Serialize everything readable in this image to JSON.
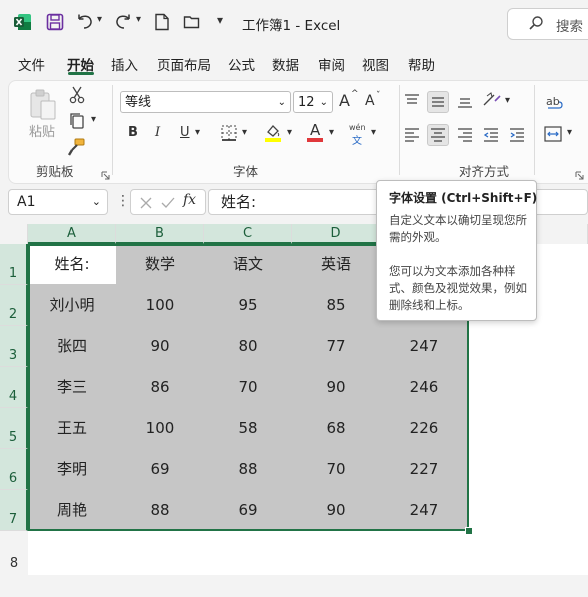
{
  "titlebar": {
    "title": "工作簿1 - Excel",
    "search_placeholder": "搜索",
    "qat_more": "▾"
  },
  "tabs": [
    "文件",
    "开始",
    "插入",
    "页面布局",
    "公式",
    "数据",
    "审阅",
    "视图",
    "帮助"
  ],
  "active_tab": "开始",
  "ribbon": {
    "clipboard": {
      "paste_label": "粘贴",
      "group_label": "剪贴板"
    },
    "font": {
      "font_name": "等线",
      "font_size": "12",
      "bold": "B",
      "italic": "I",
      "underline": "U",
      "font_color_letter": "A",
      "phonetic_top": "wén",
      "phonetic_bottom": "文",
      "grow": "A",
      "shrink": "A",
      "group_label": "字体"
    },
    "alignment": {
      "group_label": "对齐方式"
    }
  },
  "formula_bar": {
    "name_box": "A1",
    "content": "姓名:"
  },
  "columns": [
    "A",
    "B",
    "C",
    "D"
  ],
  "rows": [
    "1",
    "2",
    "3",
    "4",
    "5",
    "6",
    "7",
    "8"
  ],
  "table": {
    "header": [
      "姓名:",
      "数学",
      "语文",
      "英语",
      ""
    ],
    "rows": [
      [
        "刘小明",
        "100",
        "95",
        "85",
        ""
      ],
      [
        "张四",
        "90",
        "80",
        "77",
        "247"
      ],
      [
        "李三",
        "86",
        "70",
        "90",
        "246"
      ],
      [
        "王五",
        "100",
        "58",
        "68",
        "226"
      ],
      [
        "李明",
        "69",
        "88",
        "70",
        "227"
      ],
      [
        "周艳",
        "88",
        "69",
        "90",
        "247"
      ]
    ]
  },
  "tooltip": {
    "title": "字体设置 (Ctrl+Shift+F)",
    "line1": "自定义文本以确切呈现您所需的外观。",
    "line2": "您可以为文本添加各种样式、颜色及视觉效果，例如删除线和上标。"
  },
  "colors": {
    "accent": "#217346",
    "selection_fill": "#c6c6c6",
    "highlight_yellow": "#ffff00",
    "font_red": "#e0383b",
    "launcher_outline": "#e0383b"
  }
}
